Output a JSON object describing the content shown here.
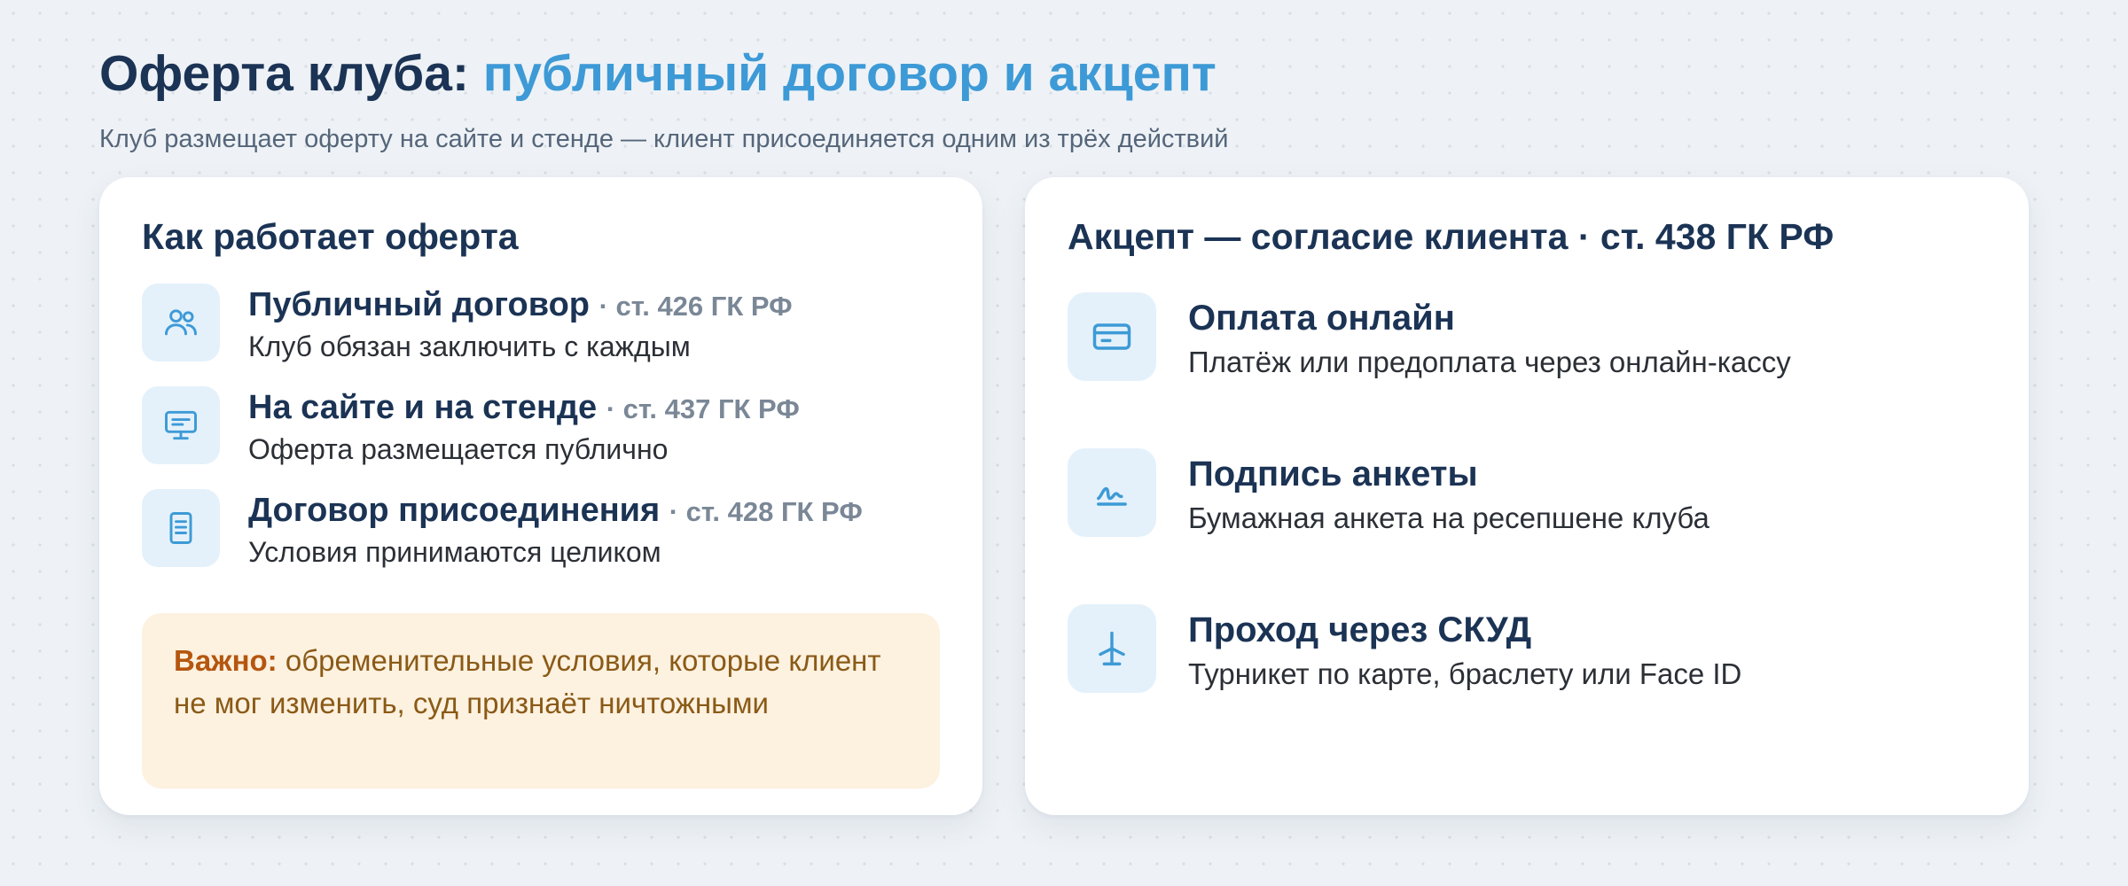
{
  "header": {
    "title_main": "Оферта клуба:",
    "title_accent": "публичный договор и акцепт",
    "subtitle": "Клуб размещает оферту на сайте и стенде — клиент присоединяется одним из трёх действий"
  },
  "offer_card": {
    "title": "Как работает оферта",
    "items": [
      {
        "icon": "people-icon",
        "title": "Публичный договор",
        "article": "· ст. 426 ГК РФ",
        "description": "Клуб обязан заключить с каждым"
      },
      {
        "icon": "monitor-icon",
        "title": "На сайте и на стенде",
        "article": "· ст. 437 ГК РФ",
        "description": "Оферта размещается публично"
      },
      {
        "icon": "document-icon",
        "title": "Договор присоединения",
        "article": "· ст. 428 ГК РФ",
        "description": "Условия принимаются целиком"
      }
    ],
    "note": {
      "label": "Важно:",
      "text": "обременительные условия, которые клиент не мог изменить, суд признаёт ничтожными"
    }
  },
  "acceptance_card": {
    "title": "Акцепт — согласие клиента · ст. 438 ГК РФ",
    "items": [
      {
        "icon": "credit-card-icon",
        "title": "Оплата онлайн",
        "description": "Платёж или предоплата через онлайн-кассу"
      },
      {
        "icon": "signature-icon",
        "title": "Подпись анкеты",
        "description": "Бумажная анкета на ресепшене клуба"
      },
      {
        "icon": "turnstile-icon",
        "title": "Проход через СКУД",
        "description": "Турникет по карте, браслету или Face ID"
      }
    ]
  },
  "colors": {
    "background": "#eef2f6",
    "heading": "#1b3354",
    "accent": "#3d9ad6",
    "icon_bg": "#e4f1fb",
    "note_bg": "#fdf1e0",
    "note_label": "#b5560e",
    "note_text": "#8a5a16"
  }
}
